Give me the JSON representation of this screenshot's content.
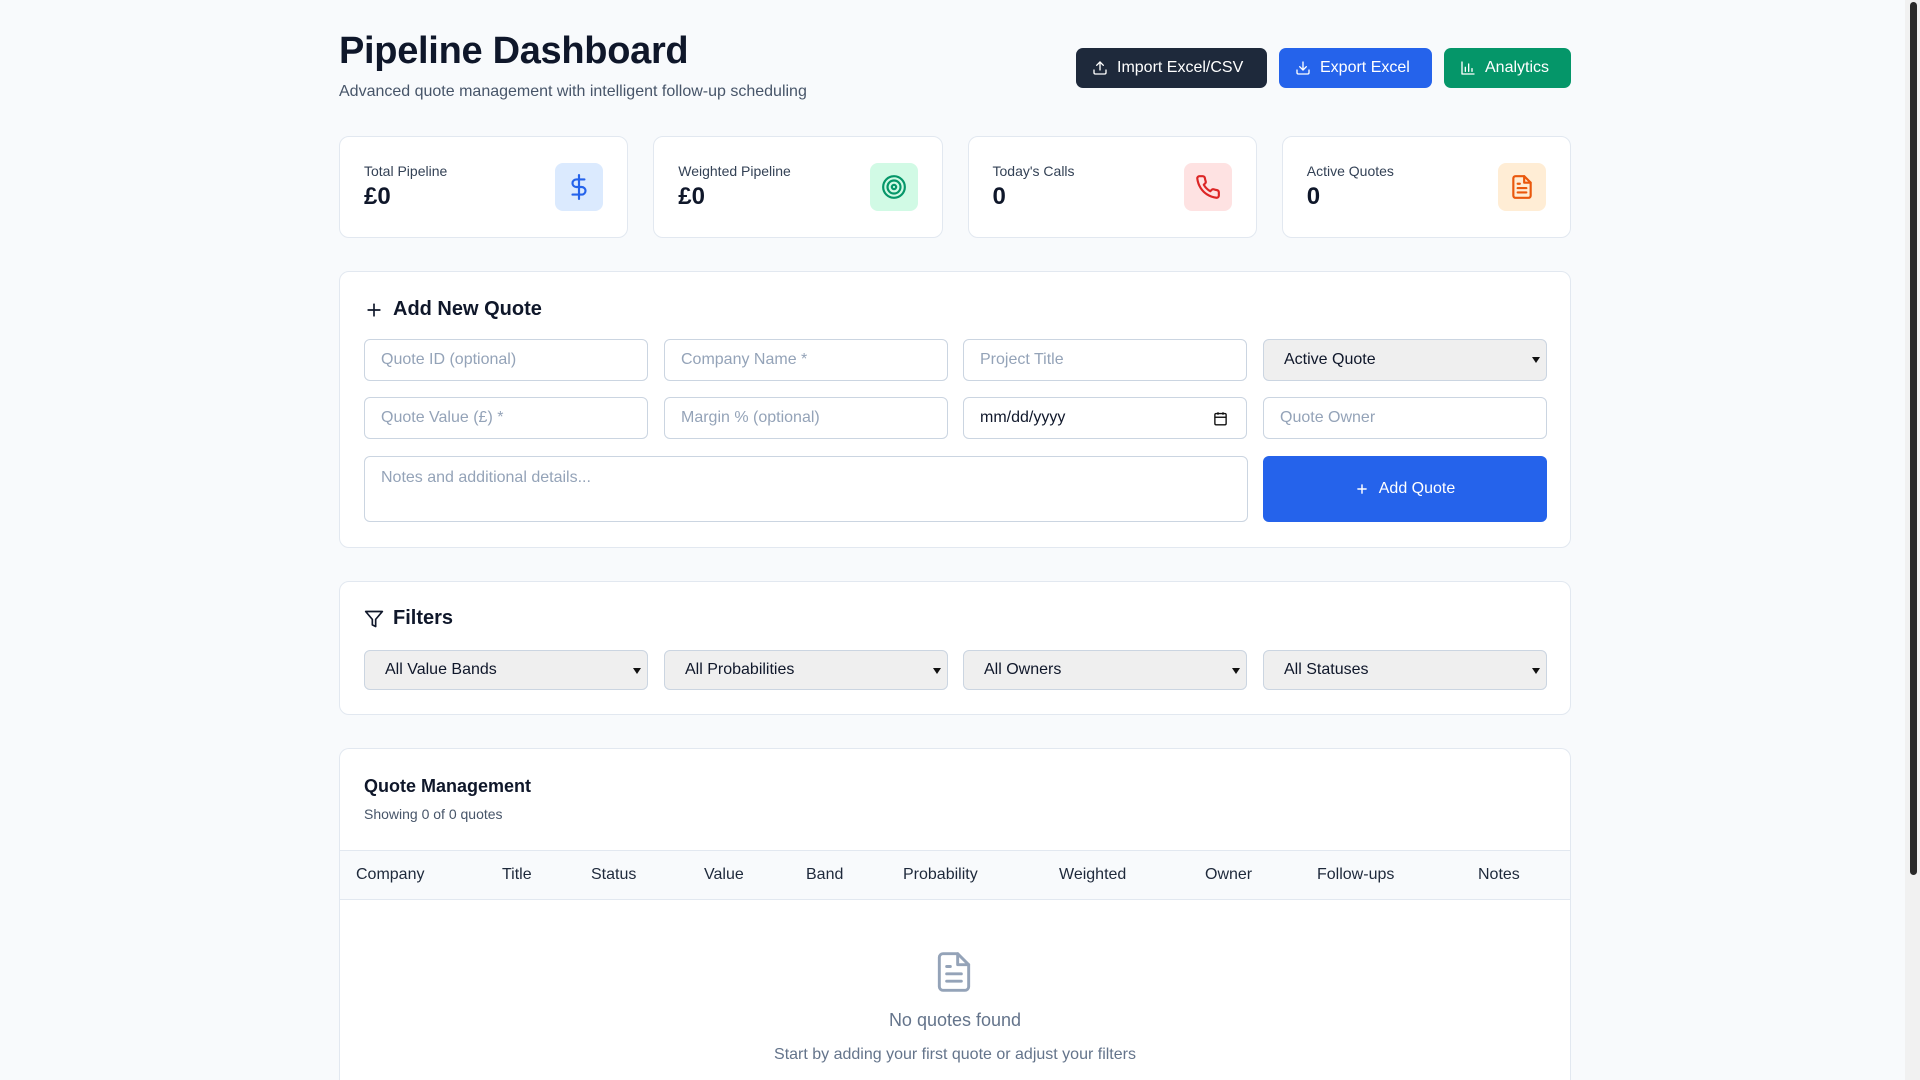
{
  "header": {
    "title": "Pipeline Dashboard",
    "subtitle": "Advanced quote management with intelligent follow-up scheduling",
    "buttons": {
      "import": "Import Excel/CSV",
      "export": "Export Excel",
      "analytics": "Analytics"
    }
  },
  "stats": [
    {
      "label": "Total Pipeline",
      "value": "£0",
      "icon": "dollar-icon"
    },
    {
      "label": "Weighted Pipeline",
      "value": "£0",
      "icon": "target-icon"
    },
    {
      "label": "Today's Calls",
      "value": "0",
      "icon": "phone-icon"
    },
    {
      "label": "Active Quotes",
      "value": "0",
      "icon": "document-icon"
    }
  ],
  "add_quote": {
    "title": "Add New Quote",
    "fields": {
      "quote_id": "Quote ID (optional)",
      "company": "Company Name *",
      "project": "Project Title",
      "status_selected": "Active Quote",
      "value": "Quote Value (£) *",
      "margin": "Margin % (optional)",
      "date": "mm/dd/yyyy",
      "owner": "Quote Owner",
      "notes": "Notes and additional details..."
    },
    "submit": "Add Quote"
  },
  "filters": {
    "title": "Filters",
    "value_band": "All Value Bands",
    "probability": "All Probabilities",
    "owner": "All Owners",
    "status": "All Statuses"
  },
  "table": {
    "title": "Quote Management",
    "subtitle": "Showing 0 of 0 quotes",
    "columns": [
      "Company",
      "Title",
      "Status",
      "Value",
      "Band",
      "Probability",
      "Weighted",
      "Owner",
      "Follow-ups",
      "Notes"
    ],
    "empty_title": "No quotes found",
    "empty_subtitle": "Start by adding your first quote or adjust your filters"
  },
  "colors": {
    "primary": "#2563eb",
    "dark": "#1e293b",
    "success": "#059669",
    "background": "#f8fafc"
  }
}
